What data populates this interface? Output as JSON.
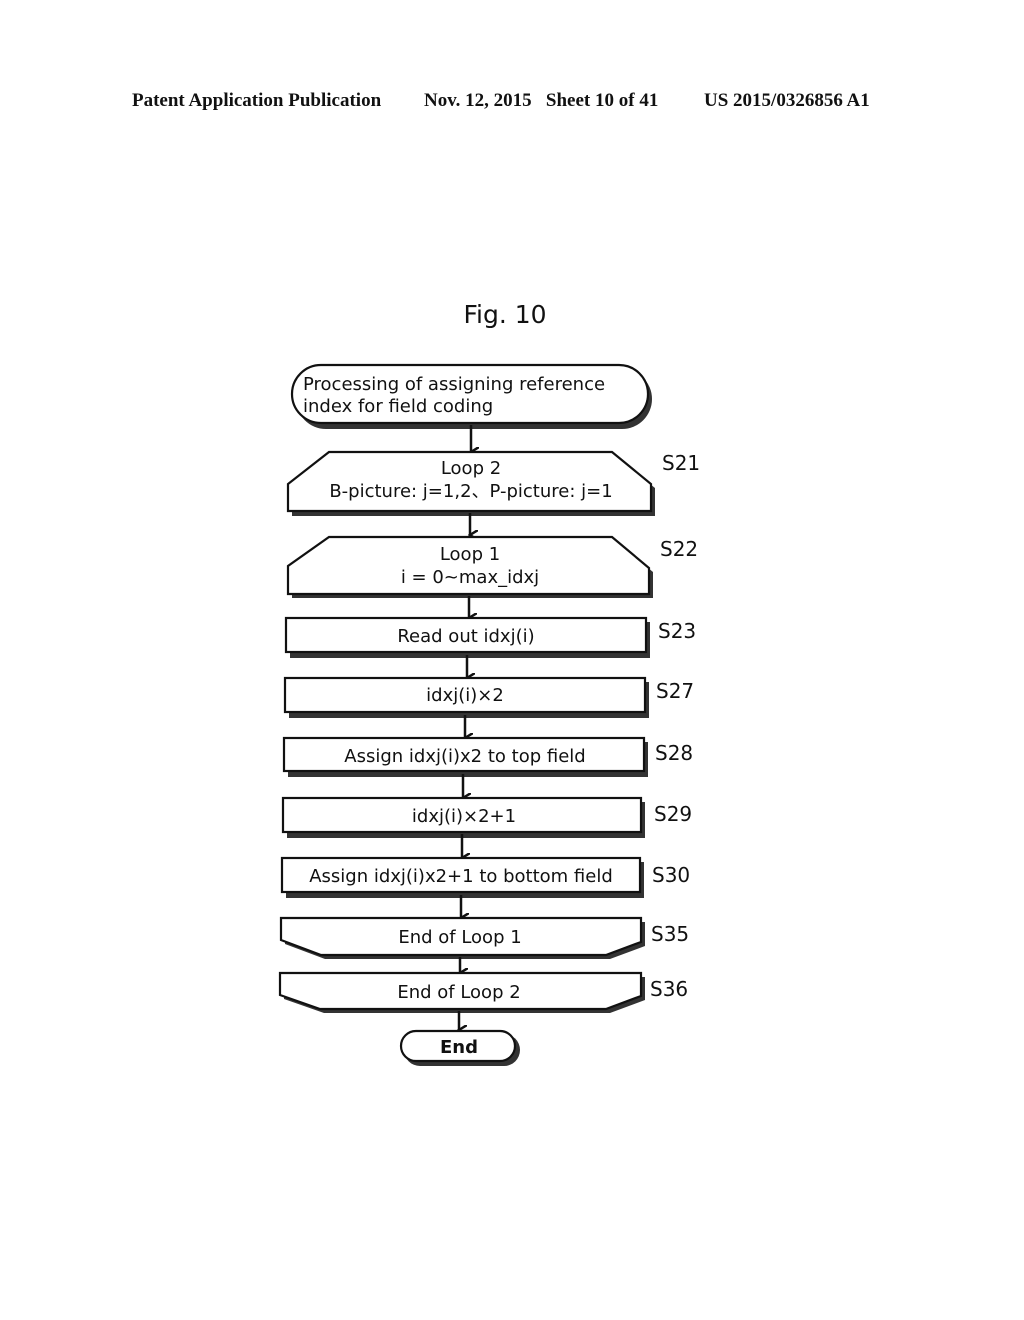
{
  "header": {
    "publication": "Patent Application Publication",
    "date_sheet": "Nov. 12, 2015   Sheet 10 of 41",
    "patent_number": "US 2015/0326856 A1"
  },
  "figure": {
    "title": "Fig. 10"
  },
  "flowchart": {
    "start": {
      "line1": "Processing of assigning reference",
      "line2": "index for field coding"
    },
    "steps": [
      {
        "id": "S21",
        "type": "loop-start",
        "line1": "Loop 2",
        "line2": "B-picture: j=1,2、P-picture: j=1"
      },
      {
        "id": "S22",
        "type": "loop-start",
        "line1": "Loop 1",
        "line2": "i = 0~max_idxj"
      },
      {
        "id": "S23",
        "type": "process",
        "line1": "Read out idxj(i)"
      },
      {
        "id": "S27",
        "type": "process",
        "line1": "idxj(i)×2"
      },
      {
        "id": "S28",
        "type": "process",
        "line1": "Assign idxj(i)x2 to top field"
      },
      {
        "id": "S29",
        "type": "process",
        "line1": "idxj(i)×2+1"
      },
      {
        "id": "S30",
        "type": "process",
        "line1": "Assign idxj(i)x2+1 to bottom field"
      },
      {
        "id": "S35",
        "type": "loop-end",
        "line1": "End of Loop 1"
      },
      {
        "id": "S36",
        "type": "loop-end",
        "line1": "End of Loop 2"
      }
    ],
    "end": {
      "label": "End"
    }
  }
}
